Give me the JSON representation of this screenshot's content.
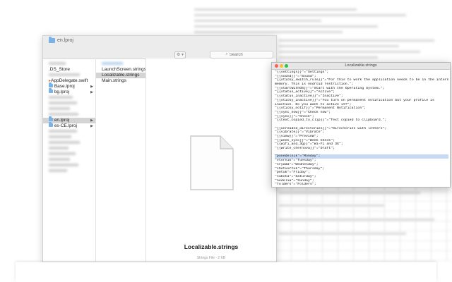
{
  "finder": {
    "title": "en.lproj",
    "search_placeholder": "Search",
    "view_button": "⚙ ▾",
    "sidebar": {
      "items": [
        {
          "label": ".DS_Store",
          "has_children": false
        },
        {
          "label": "AppDelegate.swift",
          "has_children": false
        },
        {
          "label": "Base.lproj",
          "has_children": true
        },
        {
          "label": "bg.lproj",
          "has_children": true
        },
        {
          "label": "en.lproj",
          "has_children": true,
          "selected": true
        },
        {
          "label": "es-CE.lproj",
          "has_children": true
        }
      ]
    },
    "files": [
      {
        "label": "LaunchScreen.strings",
        "selected": false
      },
      {
        "label": "Localizable.strings",
        "selected": true
      },
      {
        "label": "Main.strings",
        "selected": false
      }
    ],
    "preview": {
      "name": "Localizable.strings",
      "info": "Strings File - 2 KB"
    }
  },
  "editor": {
    "title": "Localizable.strings",
    "lines": [
      "\"{{settings}}\"=\"Settings\";",
      "\"{{sound}}\"=\"Sound\";",
      "\"{{sticky_switch_rule}}\"=\"For this to work the application needs to be in the internal",
      "memory. This is Android restriction.\";",
      "\"{{startWithOS}}\"=\"Start with the Operating System.\";",
      "\"{{status_active}}\"=\"Active\";",
      "\"{{status_inactive}}\"=\"Inactive\";",
      "\"{{sticky_inactive}}\"=\"You turn on permanent notification but your profile is",
      "inactive. Do you want to active it?\";",
      "\"{{sticky_notif}}\"=\"Permanent Notification\";",
      "\"{{sync_now}}\"=\"Check now\";",
      "\"{{sync}}\"=\"Check\";",
      "\"{{text_copied_to_clip}}\"=\"Text copied to clipboard.\";",
      "",
      "\"{{unreaded_directories}}\"=\"Directories with letters\";",
      "\"{{vibrate}}\"=\"Vibrate\";",
      "\"{{view}}\"=\"Preview\";",
      "\"{{week_sync}}\"=\"Week Check\";",
      "\"{{wifi_and_3g}}\"=\"Wi-Fi and 3G\";",
      "\"{{write_chernova}}\"=\"Draft\";",
      "",
      "\"ponedelnik\"=\"Monday\";",
      "\"vtornik\"=\"Tuesday\";",
      "\"sryada\"=\"Wednesday\";",
      "\"chetvurtuk\"=\"Thursday\";",
      "\"petuk\"=\"Friday\";",
      "\"subota\"=\"Saturday\";",
      "\"nedelia\"=\"Sunday\";",
      "\"folders\"=\"Folders\";"
    ],
    "highlighted_lines": [
      21
    ]
  },
  "colors": {
    "close": "#fc5f57",
    "minimize": "#fdbc2e",
    "zoom": "#28c840",
    "selection": "#d4d4d4",
    "highlight": "#c6daf6"
  }
}
